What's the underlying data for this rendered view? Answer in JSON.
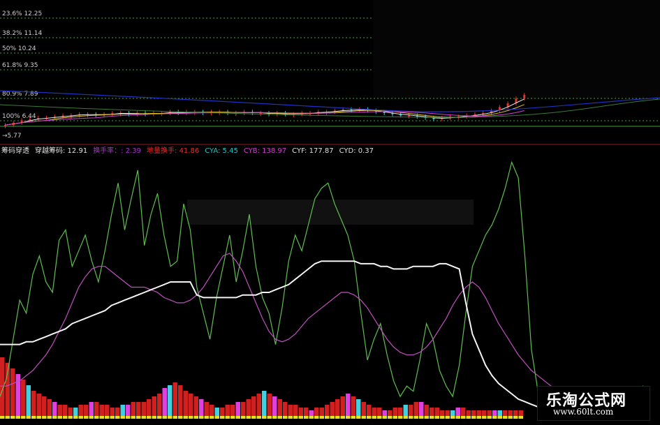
{
  "chart_data": [
    {
      "type": "line",
      "panel": "price-candles",
      "fib_levels": [
        {
          "label": "23.6% 12.25",
          "pct": 23.6,
          "price": 12.25
        },
        {
          "label": "38.2% 11.14",
          "pct": 38.2,
          "price": 11.14
        },
        {
          "label": "50% 10.24",
          "pct": 50,
          "price": 10.24
        },
        {
          "label": "61.8% 9.35",
          "pct": 61.8,
          "price": 9.35
        },
        {
          "label": "80.9% 7.89",
          "pct": 80.9,
          "price": 7.89
        },
        {
          "label": "100% 6.44",
          "pct": 100,
          "price": 6.44
        }
      ],
      "low_marker": "5.77",
      "ylim": [
        5.5,
        13.5
      ],
      "close": [
        6.1,
        6.3,
        6.5,
        6.6,
        6.7,
        6.7,
        6.8,
        6.9,
        6.9,
        7.0,
        7.0,
        6.9,
        7.0,
        7.1,
        7.1,
        7.0,
        7.1,
        7.0,
        7.1,
        7.1,
        7.2,
        7.1,
        7.2,
        7.2,
        7.1,
        7.2,
        7.2,
        7.1,
        7.1,
        7.2,
        7.1,
        7.1,
        7.0,
        7.1,
        7.0,
        7.0,
        7.1,
        7.1,
        7.2,
        7.2,
        7.3,
        7.4,
        7.3,
        7.4,
        7.3,
        7.2,
        7.1,
        7.0,
        6.9,
        6.9,
        6.8,
        6.7,
        6.6,
        6.7,
        6.8,
        6.8,
        6.9,
        7.0,
        7.1,
        7.3,
        7.6,
        7.9,
        8.3,
        8.6
      ]
    },
    {
      "type": "line",
      "panel": "indicator",
      "legend": [
        {
          "text": "筹码穿透",
          "color": "#e0e0e0"
        },
        {
          "text": "穿越筹码: 12.91",
          "color": "#e0e0e0"
        },
        {
          "text": "换手率：: 2.39",
          "color": "#b030d0"
        },
        {
          "text": "地量换手: 41.86",
          "color": "#e03030"
        },
        {
          "text": "CYA: 5.45",
          "color": "#30c0c0"
        },
        {
          "text": "CYB: 138.97",
          "color": "#d040d0"
        },
        {
          "text": "CYF: 177.87",
          "color": "#e0e0e0"
        },
        {
          "text": "CYD: 0.37",
          "color": "#e0e0e0"
        }
      ],
      "ylim": [
        0,
        100
      ],
      "series": [
        {
          "color": "#5fbf4f",
          "values": [
            8,
            15,
            30,
            45,
            40,
            55,
            62,
            52,
            48,
            68,
            72,
            58,
            64,
            70,
            60,
            52,
            64,
            78,
            90,
            72,
            84,
            95,
            66,
            78,
            86,
            70,
            58,
            60,
            82,
            72,
            50,
            40,
            30,
            46,
            58,
            70,
            52,
            64,
            78,
            58,
            46,
            40,
            28,
            42,
            60,
            70,
            64,
            74,
            84,
            88,
            90,
            82,
            76,
            70,
            60,
            40,
            22,
            30,
            36,
            24,
            14,
            8,
            12,
            10,
            22,
            36,
            30,
            18,
            12,
            8,
            20,
            40,
            58,
            64,
            70,
            74,
            80,
            88,
            98,
            92,
            62,
            26,
            10,
            6,
            8,
            4,
            6,
            4,
            3,
            6,
            5,
            4,
            3,
            2,
            3,
            4,
            5,
            4,
            12,
            10
          ]
        },
        {
          "color": "#c050c0",
          "values": [
            12,
            12,
            13,
            14,
            16,
            18,
            21,
            24,
            28,
            33,
            38,
            44,
            50,
            54,
            57,
            58,
            58,
            56,
            54,
            52,
            50,
            50,
            50,
            49,
            48,
            46,
            45,
            44,
            44,
            45,
            47,
            50,
            54,
            58,
            62,
            63,
            60,
            56,
            50,
            44,
            38,
            33,
            30,
            29,
            30,
            32,
            35,
            38,
            40,
            42,
            44,
            46,
            48,
            48,
            47,
            45,
            42,
            38,
            34,
            30,
            27,
            25,
            24,
            24,
            25,
            27,
            30,
            34,
            38,
            43,
            47,
            50,
            52,
            50,
            46,
            41,
            36,
            32,
            28,
            24,
            21,
            18,
            16,
            14,
            12,
            11,
            10,
            9,
            8,
            8,
            7,
            7,
            6,
            6,
            6,
            5,
            5,
            5,
            5,
            5
          ]
        },
        {
          "color": "#f4f4f4",
          "values": [
            28,
            28,
            28,
            28,
            29,
            29,
            30,
            31,
            32,
            33,
            34,
            36,
            37,
            38,
            39,
            40,
            41,
            43,
            44,
            45,
            46,
            47,
            48,
            49,
            50,
            51,
            52,
            52,
            52,
            52,
            47,
            46,
            46,
            46,
            46,
            46,
            46,
            47,
            47,
            47,
            48,
            48,
            49,
            50,
            51,
            53,
            55,
            57,
            59,
            60,
            60,
            60,
            60,
            60,
            60,
            59,
            59,
            59,
            58,
            58,
            57,
            57,
            57,
            58,
            58,
            58,
            58,
            59,
            59,
            58,
            57,
            44,
            32,
            26,
            20,
            16,
            13,
            11,
            9,
            7,
            6,
            5,
            4,
            3,
            3,
            3,
            3,
            2,
            2,
            2,
            2,
            2,
            2,
            2,
            2,
            2,
            2,
            2,
            2,
            2
          ]
        }
      ],
      "volume": [
        22,
        20,
        18,
        16,
        14,
        12,
        10,
        9,
        8,
        7,
        6,
        5,
        5,
        4,
        4,
        5,
        5,
        6,
        6,
        5,
        5,
        4,
        4,
        5,
        5,
        6,
        6,
        6,
        7,
        8,
        9,
        11,
        12,
        13,
        12,
        10,
        9,
        8,
        7,
        6,
        5,
        4,
        4,
        5,
        5,
        6,
        6,
        7,
        8,
        9,
        10,
        9,
        8,
        7,
        6,
        5,
        5,
        4,
        4,
        3,
        4,
        4,
        5,
        6,
        7,
        8,
        9,
        8,
        7,
        6,
        5,
        4,
        4,
        3,
        3,
        4,
        4,
        5,
        5,
        6,
        6,
        5,
        4,
        4,
        3,
        3,
        3,
        4,
        4,
        3,
        3,
        3,
        3,
        3,
        3,
        3,
        3,
        3,
        3,
        3
      ]
    }
  ],
  "watermark": {
    "name": "乐淘公式网",
    "url": "www.60lt.com"
  },
  "colors": {
    "bg": "#000000",
    "fib": "#3fa33f",
    "up_candle": "#e03030",
    "down_candle": "#30c8d8",
    "grid": "#1a1a1a"
  }
}
